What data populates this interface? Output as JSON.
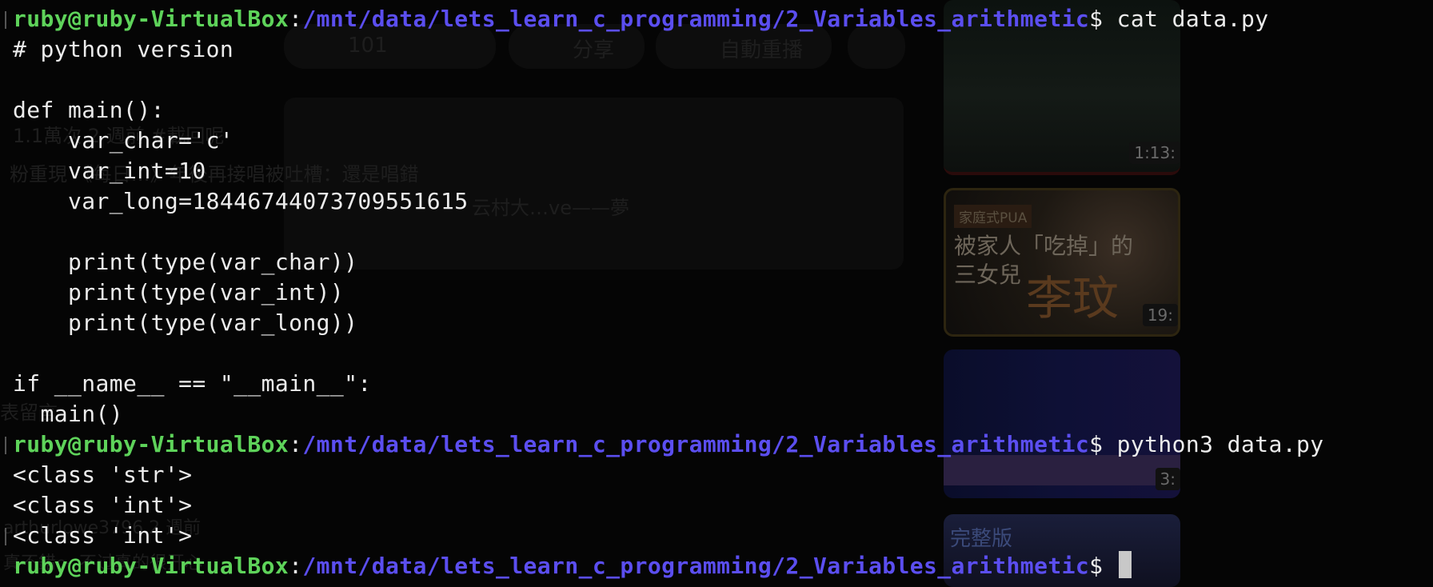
{
  "background": {
    "video_actions": [
      "101",
      "分享",
      "自動重播"
    ],
    "ghost_lines": [
      "1.1萬次 2 週前 #載回呢",
      "粉重現 《每日…》年後再接唱被吐槽：還是唱錯",
      "云村大…ve——夢",
      "表留言",
      "arthurlowe3796 2 週前",
      "真不錯～ 不过真的很开心"
    ],
    "thumbnails": [
      {
        "duration": "1:13:",
        "tag": "",
        "title": "",
        "big": ""
      },
      {
        "duration": "19:",
        "tag": "家庭式PUA",
        "title": "被家人「吃掉」的\n三女兒",
        "big": "李玟"
      },
      {
        "duration": "3:",
        "tag": "",
        "title": "",
        "big": ""
      },
      {
        "duration": "",
        "tag": "",
        "title": "",
        "big": "完整版"
      }
    ]
  },
  "terminal": {
    "colors": {
      "user": "#5ed35a",
      "path": "#5b4ef0",
      "text": "#ececec",
      "background": "#000000"
    },
    "prompt": {
      "user_host": "ruby@ruby-VirtualBox",
      "colon": ":",
      "path": "/mnt/data/lets_learn_c_programming/2_Variables_arithmetic",
      "dollar": "$ "
    },
    "commands": {
      "first": "cat data.py",
      "second": "python3 data.py",
      "third": ""
    },
    "file_lines": [
      "# python version",
      "",
      "def main():",
      "    var_char='c'",
      "    var_int=10",
      "    var_long=18446744073709551615",
      "",
      "    print(type(var_char))",
      "    print(type(var_int))",
      "    print(type(var_long))",
      "",
      "if __name__ == \"__main__\":",
      "  main()"
    ],
    "output_lines": [
      "<class 'str'>",
      "<class 'int'>",
      "<class 'int'>"
    ]
  }
}
